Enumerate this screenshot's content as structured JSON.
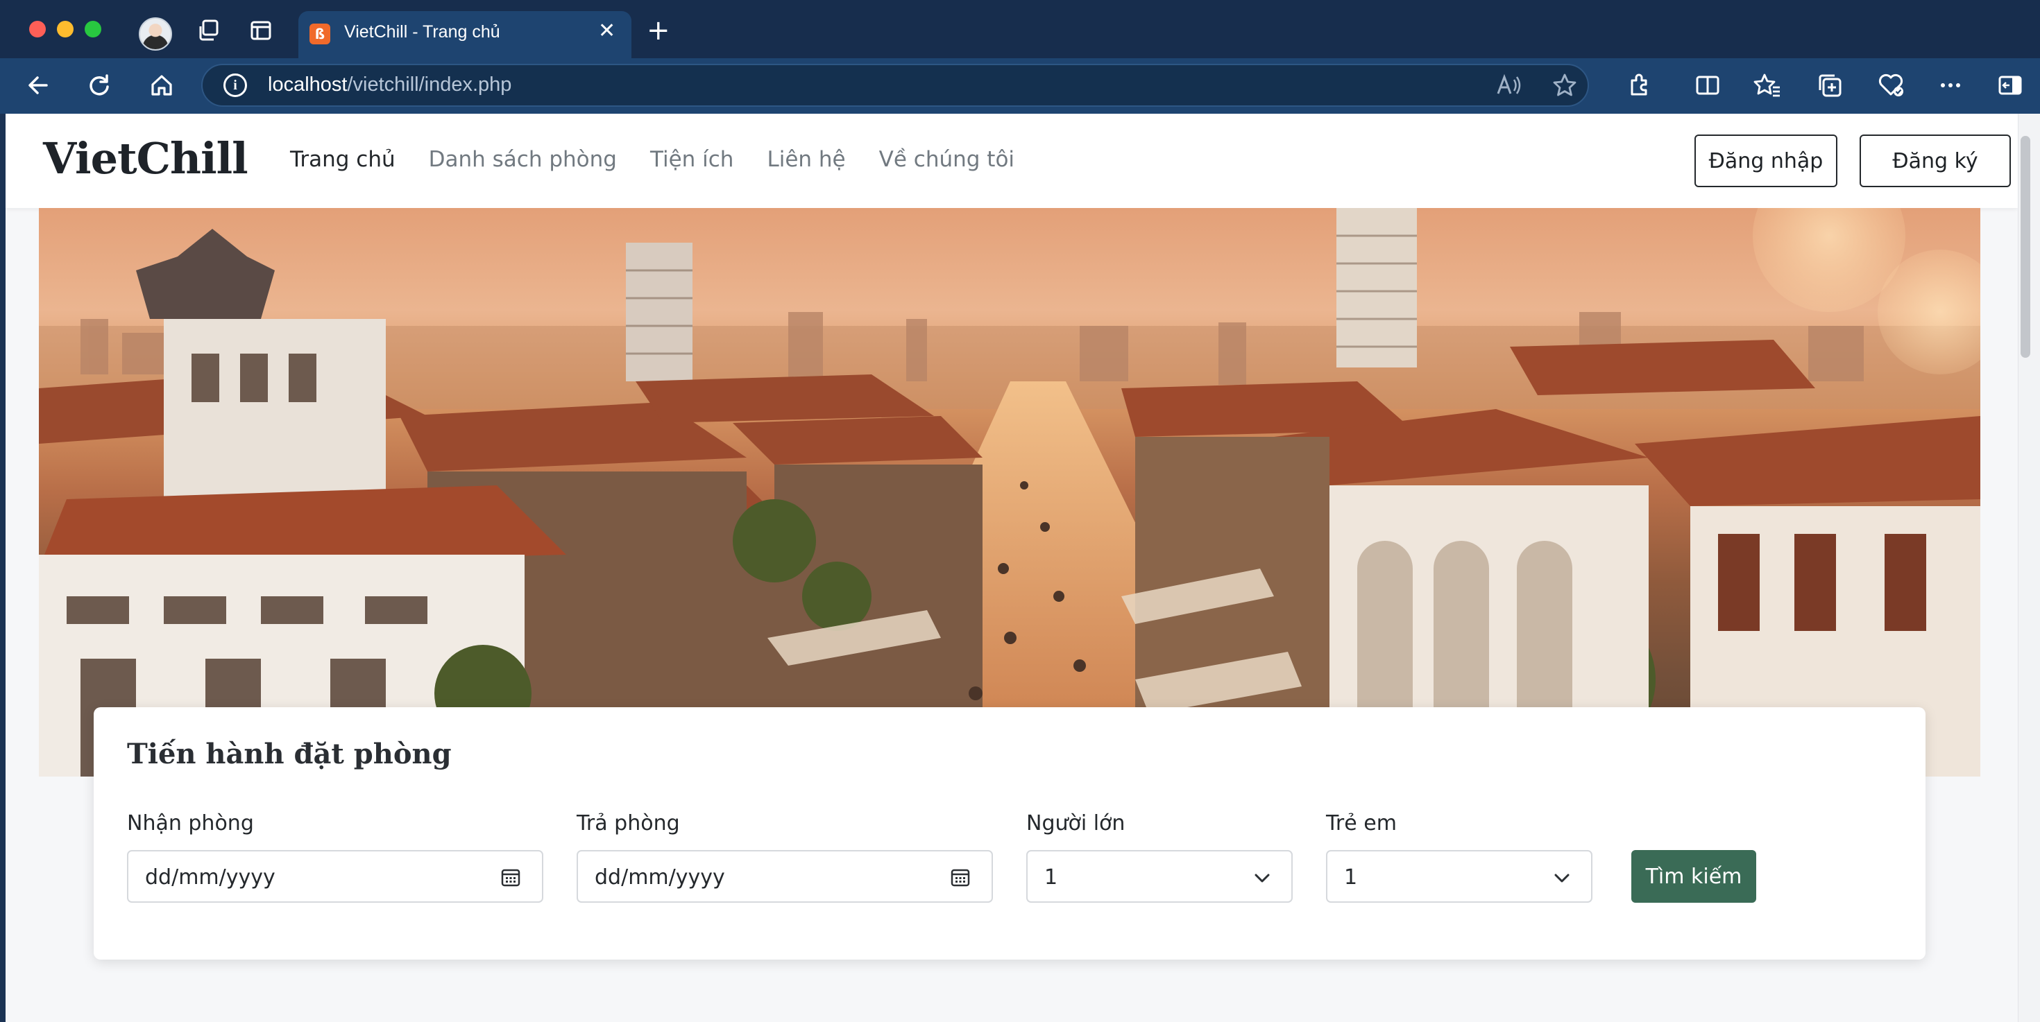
{
  "browser": {
    "tab_title": "VietChill - Trang chủ",
    "url_host": "localhost",
    "url_path": "/vietchill/index.php"
  },
  "nav": {
    "brand": "VietChill",
    "links": [
      "Trang chủ",
      "Danh sách phòng",
      "Tiện ích",
      "Liên hệ",
      "Về chúng tôi"
    ],
    "login_label": "Đăng nhập",
    "register_label": "Đăng ký"
  },
  "booking": {
    "title": "Tiến hành đặt phòng",
    "checkin_label": "Nhận phòng",
    "checkin_placeholder": "dd/mm/yyyy",
    "checkout_label": "Trả phòng",
    "checkout_placeholder": "dd/mm/yyyy",
    "adults_label": "Người lớn",
    "adults_value": "1",
    "children_label": "Trẻ em",
    "children_value": "1",
    "search_label": "Tìm kiếm"
  },
  "colors": {
    "browser_frame": "#1e4470",
    "primary_button": "#3a6b56",
    "page_background": "#f6f7f9"
  }
}
